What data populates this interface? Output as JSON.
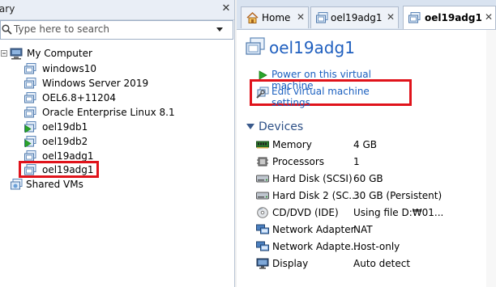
{
  "library": {
    "title": "rary",
    "close": "✕",
    "search_placeholder": "Type here to search",
    "root": "My Computer",
    "vms": [
      "windows10",
      "Windows Server 2019",
      "OEL6.8+11204",
      "Oracle Enterprise Linux 8.1",
      "oel19db1",
      "oel19db2",
      "oel19adg1",
      "oel19adg1"
    ],
    "shared": "Shared VMs"
  },
  "tabs": [
    {
      "label": "Home",
      "close": "✕"
    },
    {
      "label": "oel19adg1",
      "close": "✕"
    },
    {
      "label": "oel19adg1",
      "close": "✕"
    }
  ],
  "vm": {
    "name": "oel19adg1",
    "power_on": "Power on this virtual machine",
    "edit_settings": "Edit virtual machine settings"
  },
  "devices": {
    "title": "Devices",
    "items": [
      {
        "name": "Memory",
        "value": "4 GB",
        "icon": "memory-icon"
      },
      {
        "name": "Processors",
        "value": "1",
        "icon": "processor-icon"
      },
      {
        "name": "Hard Disk (SCSI)",
        "value": "60 GB",
        "icon": "hard-disk-icon"
      },
      {
        "name": "Hard Disk 2 (SC...",
        "value": "30 GB (Persistent)",
        "icon": "hard-disk-icon"
      },
      {
        "name": "CD/DVD (IDE)",
        "value": "Using file D:₩01...",
        "icon": "cd-dvd-icon"
      },
      {
        "name": "Network Adapter",
        "value": "NAT",
        "icon": "network-icon"
      },
      {
        "name": "Network Adapte...",
        "value": "Host-only",
        "icon": "network-icon"
      },
      {
        "name": "Display",
        "value": "Auto detect",
        "icon": "display-icon"
      }
    ]
  },
  "colors": {
    "selection_outline": "#e0131b",
    "link": "#1a5fbf",
    "title": "#1f5fbf"
  }
}
